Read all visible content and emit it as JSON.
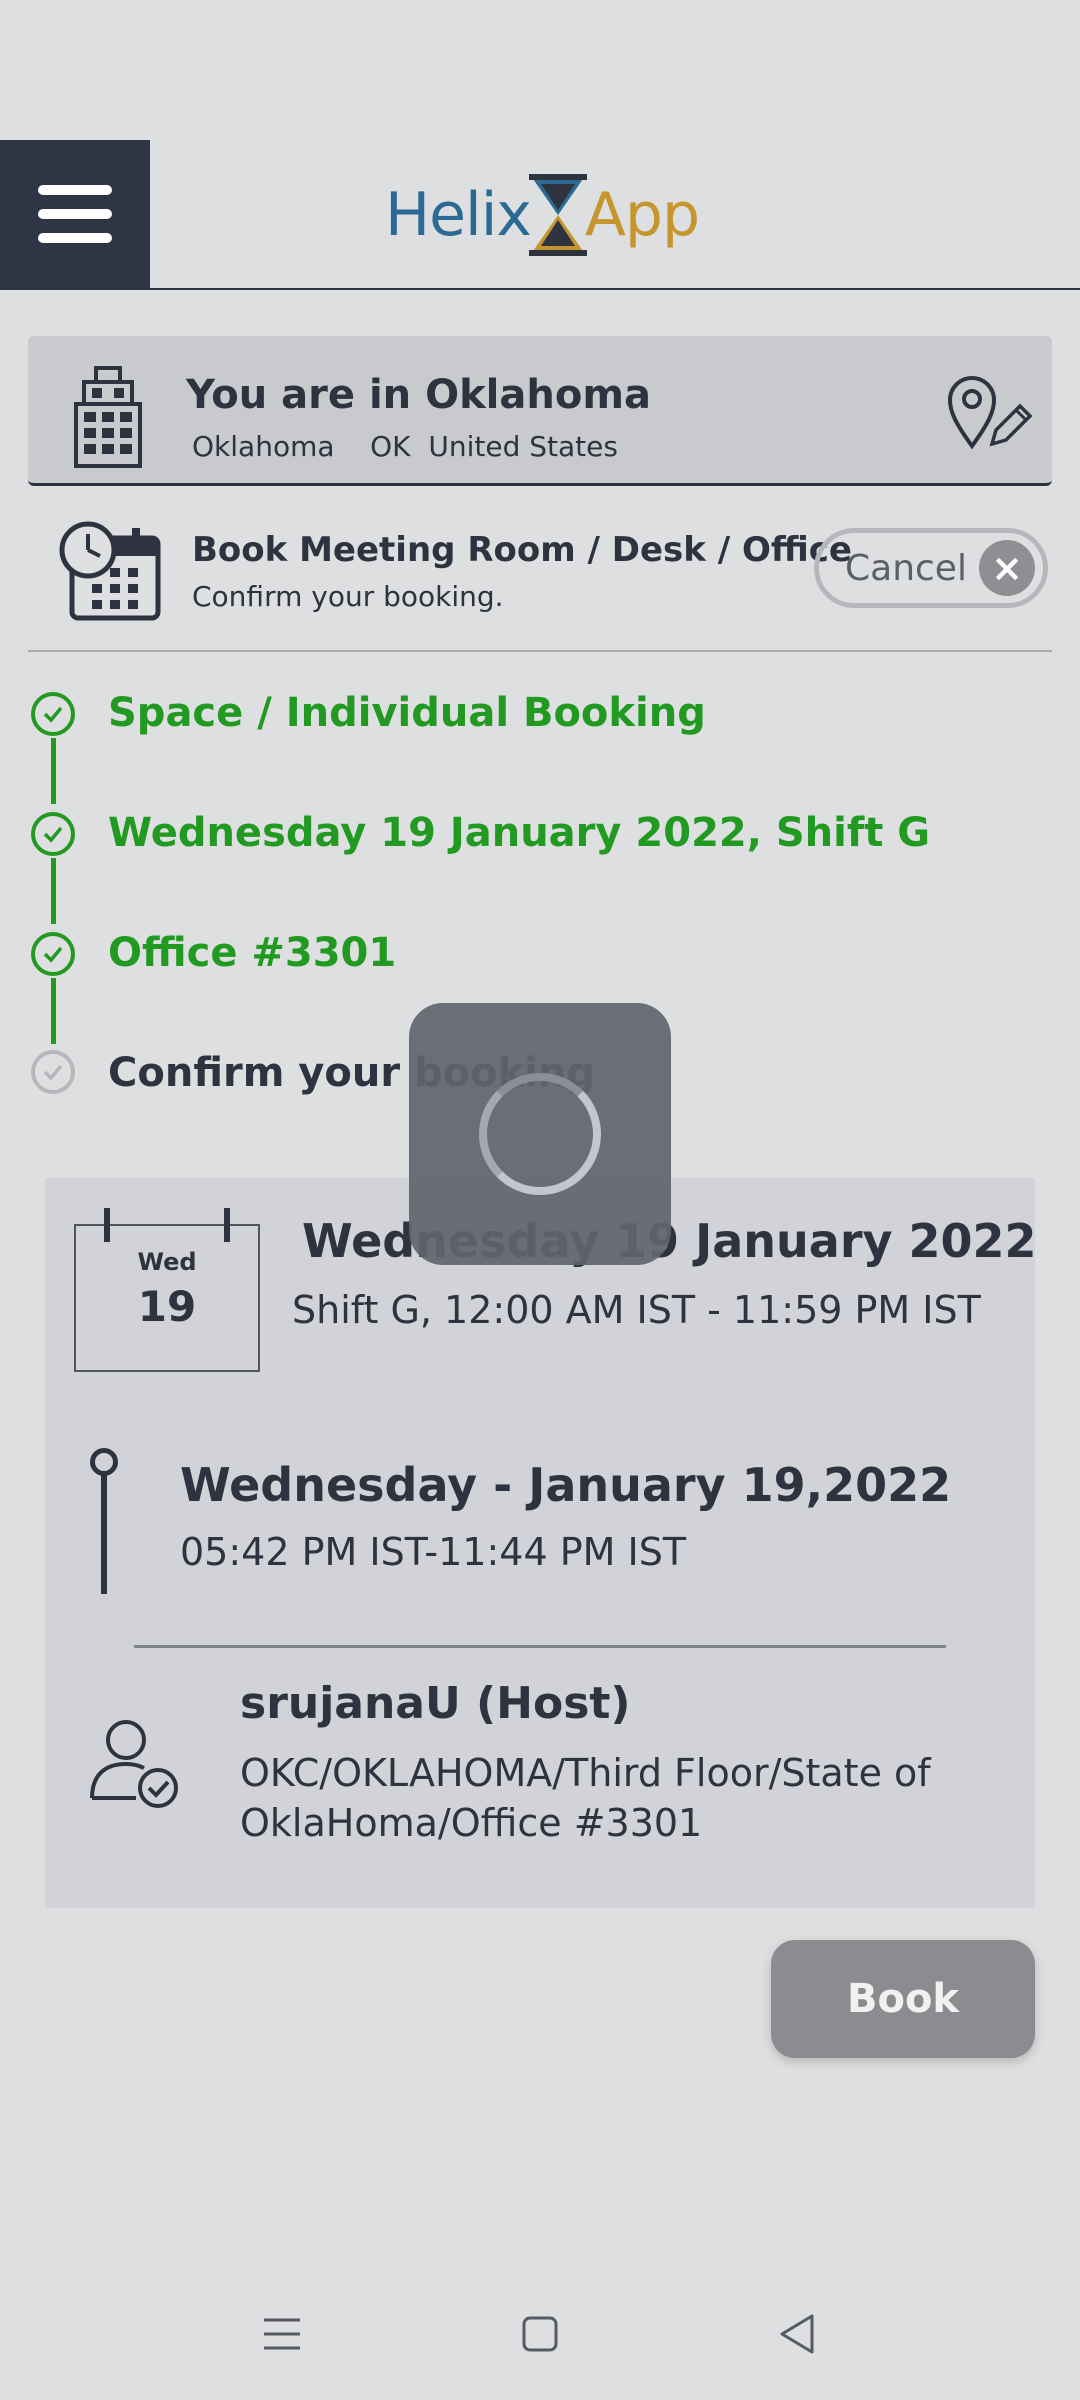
{
  "header": {
    "logo_part1": "Helix",
    "logo_part2": "App",
    "menu_icon": "hamburger-menu-icon"
  },
  "location": {
    "title": "You are in Oklahoma",
    "city": "Oklahoma",
    "state": "OK",
    "country": "United States",
    "building_icon": "building-icon",
    "edit_icon": "location-edit-icon"
  },
  "booking": {
    "title": "Book Meeting Room / Desk / Office",
    "subtitle": "Confirm your booking.",
    "cancel_label": "Cancel",
    "cancel_icon": "close-icon"
  },
  "steps": [
    {
      "label": "Space / Individual Booking",
      "status": "done"
    },
    {
      "label": "Wednesday 19 January 2022, Shift G",
      "status": "done"
    },
    {
      "label": "Office #3301",
      "status": "done"
    },
    {
      "label": "Confirm your booking",
      "status": "pending"
    }
  ],
  "details": {
    "cal_day": "Wed",
    "cal_num": "19",
    "date_title": "Wednesday 19 January 2022",
    "shift_text": "Shift G, 12:00 AM IST - 11:59 PM IST",
    "time_title": "Wednesday - January 19,2022",
    "time_text": "05:42 PM IST-11:44 PM IST",
    "host_title": "srujanaU (Host)",
    "host_location": "OKC/OKLAHOMA/Third Floor/State of OklaHoma/Office #3301"
  },
  "book_label": "Book",
  "colors": {
    "accent_green": "#229a22",
    "dark": "#2f3544",
    "logo_blue": "#2b6b93",
    "logo_gold": "#c6962e"
  }
}
